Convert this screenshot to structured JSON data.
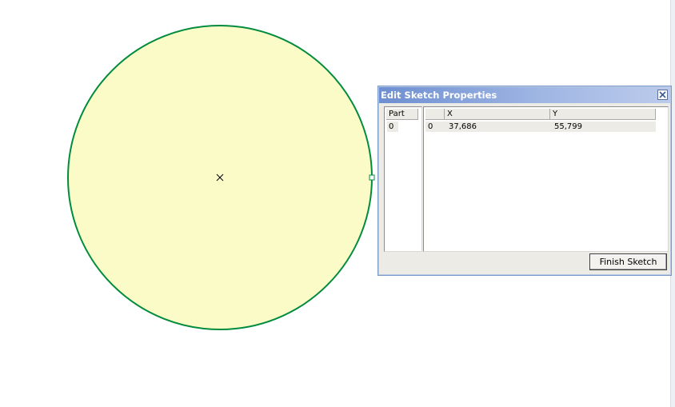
{
  "dialog": {
    "title": "Edit Sketch Properties",
    "close_icon": "close-x-icon",
    "part_column_header": "Part",
    "parts": [
      "0"
    ],
    "vertex_columns": {
      "index": "",
      "x": "X",
      "y": "Y"
    },
    "vertices": [
      {
        "index": "0",
        "x": "37,686",
        "y": "55,799"
      }
    ],
    "finish_button": "Finish Sketch"
  },
  "sketch": {
    "shape": "circle",
    "fill_color": "#fbfbc8",
    "stroke_color": "#008c3c",
    "center_marker_icon": "x-marker-icon",
    "vertex_handle_icon": "square-vertex-handle-icon"
  }
}
